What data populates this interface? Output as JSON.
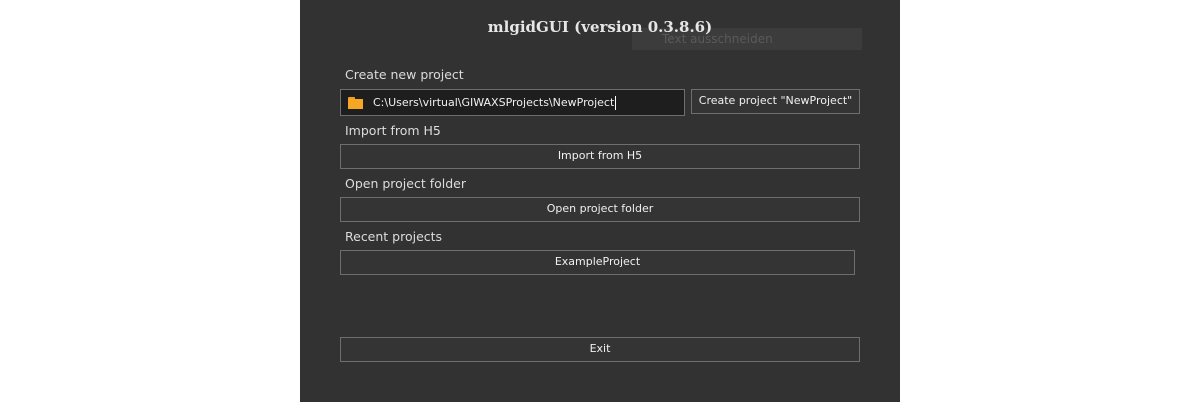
{
  "window": {
    "title": "mlgidGUI (version 0.3.8.6)",
    "ghost_tooltip": "Text ausschneiden"
  },
  "create": {
    "section_label": "Create new project",
    "path_value": "C:\\Users\\virtual\\GIWAXSProjects\\NewProject",
    "create_button": "Create project \"NewProject\""
  },
  "import_h5": {
    "section_label": "Import from H5",
    "button": "Import from H5"
  },
  "open_folder": {
    "section_label": "Open project folder",
    "button": "Open project folder"
  },
  "recent": {
    "section_label": "Recent projects",
    "items": [
      "ExampleProject"
    ]
  },
  "exit_button": "Exit",
  "icons": {
    "folder": "folder-icon"
  },
  "colors": {
    "window_bg": "#323232",
    "field_bg": "#1e1e1e",
    "border": "#6e6e6e",
    "folder": "#f5a623"
  }
}
